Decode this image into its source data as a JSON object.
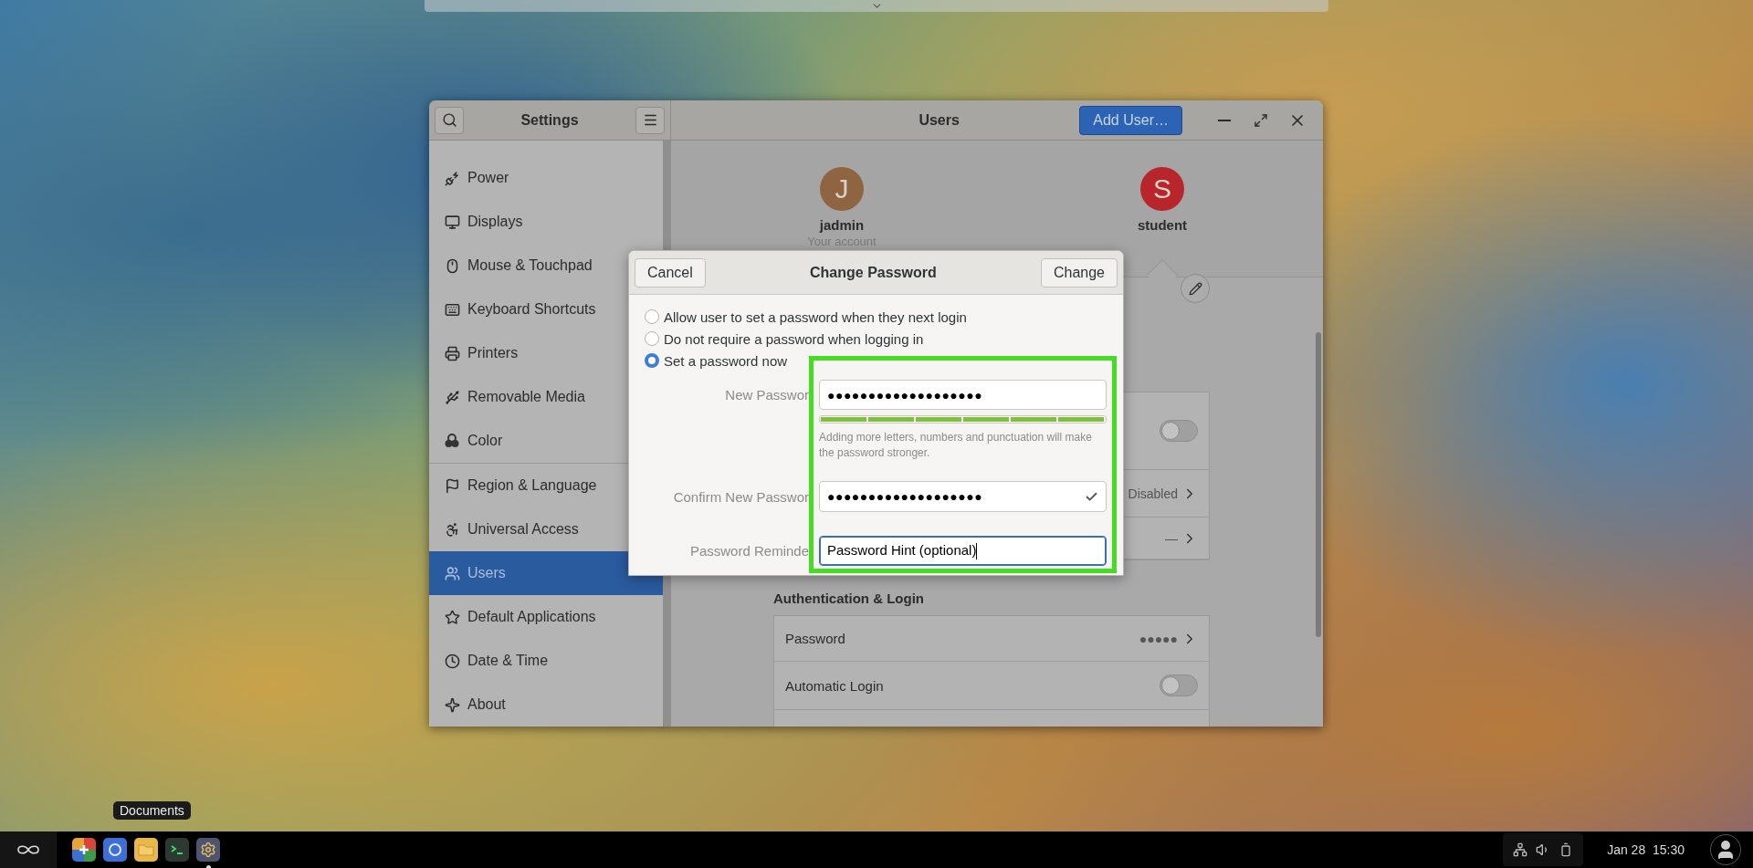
{
  "window": {
    "sidebar_title": "Settings",
    "title": "Users",
    "add_button": "Add User…"
  },
  "sidebar": {
    "items": [
      {
        "label": "Power",
        "selected": false
      },
      {
        "label": "Displays",
        "selected": false
      },
      {
        "label": "Mouse & Touchpad",
        "selected": false
      },
      {
        "label": "Keyboard Shortcuts",
        "selected": false
      },
      {
        "label": "Printers",
        "selected": false
      },
      {
        "label": "Removable Media",
        "selected": false
      },
      {
        "label": "Color",
        "selected": false
      },
      {
        "label": "Region & Language",
        "selected": false
      },
      {
        "label": "Universal Access",
        "selected": false
      },
      {
        "label": "Users",
        "selected": true
      },
      {
        "label": "Default Applications",
        "selected": false
      },
      {
        "label": "Date & Time",
        "selected": false
      },
      {
        "label": "About",
        "selected": false
      }
    ]
  },
  "users": [
    {
      "initial": "J",
      "name": "jadmin",
      "subtitle": "Your account",
      "color": "#8e6540"
    },
    {
      "initial": "S",
      "name": "student",
      "color": "#b8262b",
      "selected": true
    }
  ],
  "account_rows": [
    {
      "kind": "switch",
      "on": false
    },
    {
      "kind": "value",
      "value": "Disabled"
    },
    {
      "kind": "value",
      "value": "—"
    }
  ],
  "auth": {
    "title": "Authentication & Login",
    "rows": [
      {
        "kind": "value",
        "label": "Password",
        "value": "●●●●●"
      },
      {
        "kind": "switch",
        "label": "Automatic Login",
        "on": false
      }
    ]
  },
  "dialog": {
    "cancel": "Cancel",
    "title": "Change Password",
    "confirm": "Change",
    "options": [
      {
        "label": "Allow user to set a password when they next login",
        "selected": false
      },
      {
        "label": "Do not require a password when logging in",
        "selected": false
      },
      {
        "label": "Set a password now",
        "selected": true
      }
    ],
    "new_password": {
      "label": "New Passwor",
      "value": "●●●●●●●●●●●●●●●●●●●"
    },
    "strength": {
      "level": 1,
      "hint": "Adding more letters, numbers and punctuation will make the password stronger."
    },
    "confirm_password": {
      "label": "Confirm New Passwor",
      "value": "●●●●●●●●●●●●●●●●●●●",
      "valid": true
    },
    "reminder": {
      "label": "Password Reminde",
      "value": "Password Hint (optional)",
      "focused": true
    }
  },
  "taskbar": {
    "tooltip": "Documents",
    "apps": [
      {
        "running": false
      },
      {
        "running": false
      },
      {
        "running": false
      },
      {
        "running": false
      },
      {
        "running": true
      }
    ],
    "date": "Jan 28",
    "time": "15:30"
  }
}
